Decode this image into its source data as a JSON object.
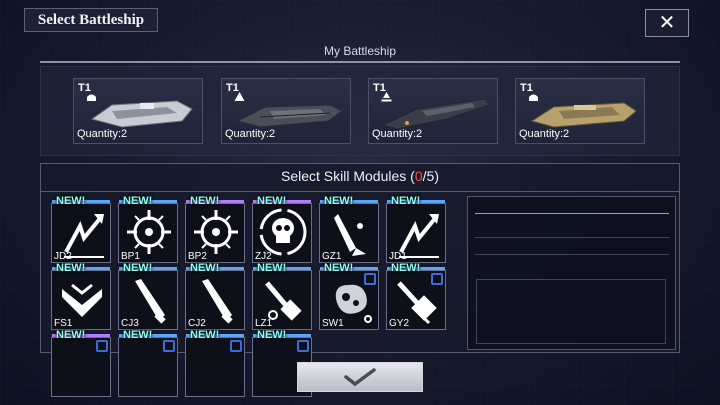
{
  "header": {
    "title": "Select Battleship",
    "close_glyph": "✕"
  },
  "my_battleship": {
    "title": "My Battleship",
    "ships": [
      {
        "tier": "T1",
        "tier_icon": "dome-class-icon",
        "quantity": "Quantity:2",
        "hull_color": "#c9ccd3"
      },
      {
        "tier": "T1",
        "tier_icon": "triangle-class-icon",
        "quantity": "Quantity:2",
        "hull_color": "#4b4e57"
      },
      {
        "tier": "T1",
        "tier_icon": "stacked-triangle-class-icon",
        "quantity": "Quantity:2",
        "hull_color": "#3b3e48"
      },
      {
        "tier": "T1",
        "tier_icon": "dome-class-icon",
        "quantity": "Quantity:2",
        "hull_color": "#b8a16c"
      }
    ]
  },
  "skill_modules": {
    "title_prefix": "Select Skill Modules (",
    "selected": "0",
    "separator": "/",
    "max": "5",
    "title_suffix": ")",
    "new_label": "NEW!",
    "modules": [
      {
        "code": "JD2",
        "icon": "lightning-arrow-icon",
        "bar": "#5aa6ff"
      },
      {
        "code": "BP1",
        "icon": "crosshair-burst-icon",
        "bar": "#5aa6ff"
      },
      {
        "code": "BP2",
        "icon": "crosshair-burst-icon",
        "bar": "#b57cff"
      },
      {
        "code": "ZJ2",
        "icon": "skull-icon",
        "bar": "#b57cff"
      },
      {
        "code": "GZ1",
        "icon": "missile-icon",
        "bar": "#5aa6ff"
      },
      {
        "code": "JD1",
        "icon": "lightning-arrow-icon",
        "bar": "#5aa6ff"
      },
      {
        "code": "FS1",
        "icon": "shield-chevron-icon",
        "bar": "#5aa6ff"
      },
      {
        "code": "CJ3",
        "icon": "shell-icon",
        "bar": "#5aa6ff"
      },
      {
        "code": "CJ2",
        "icon": "shell-icon",
        "bar": "#5aa6ff"
      },
      {
        "code": "LZ1",
        "icon": "laser-cannon-icon",
        "bar": "#5aa6ff"
      },
      {
        "code": "SW1",
        "icon": "nebula-icon",
        "bar": "#5aa6ff"
      },
      {
        "code": "GY2",
        "icon": "drill-cannon-icon",
        "bar": "#5aa6ff"
      },
      {
        "code": "",
        "icon": "chip-icon",
        "bar": "#b57cff"
      },
      {
        "code": "",
        "icon": "chip-icon",
        "bar": "#5aa6ff"
      },
      {
        "code": "",
        "icon": "chip-icon",
        "bar": "#5aa6ff"
      },
      {
        "code": "",
        "icon": "chip-icon",
        "bar": "#5aa6ff"
      }
    ]
  },
  "confirm": {
    "glyph": "✓"
  }
}
